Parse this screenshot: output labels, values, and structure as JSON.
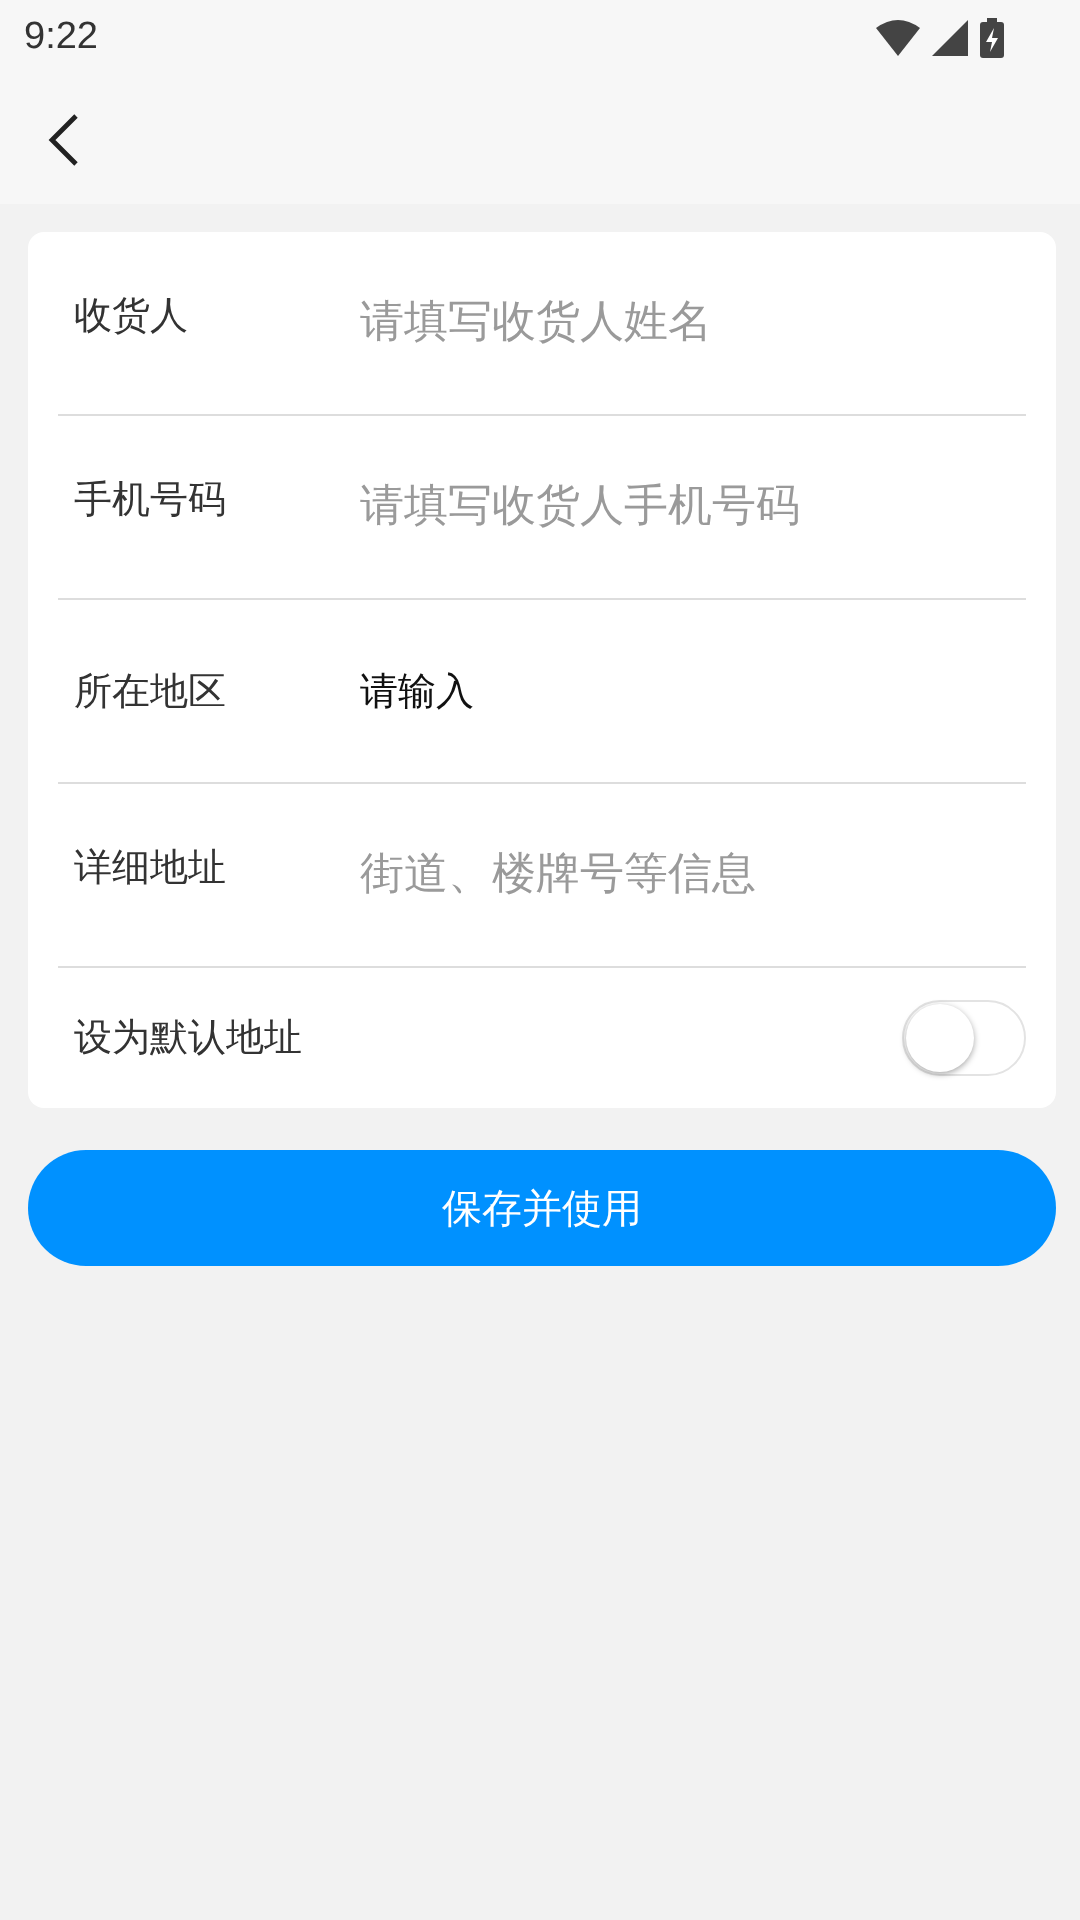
{
  "status_bar": {
    "time": "9:22"
  },
  "form": {
    "fields": [
      {
        "kind": "input",
        "label": "收货人",
        "placeholder": "请填写收货人姓名"
      },
      {
        "kind": "input",
        "label": "手机号码",
        "placeholder": "请填写收货人手机号码"
      },
      {
        "kind": "select",
        "label": "所在地区",
        "value": "请输入"
      },
      {
        "kind": "input",
        "label": "详细地址",
        "placeholder": "街道、楼牌号等信息"
      }
    ],
    "default_switch": {
      "label": "设为默认地址",
      "on": false
    }
  },
  "submit_button": "保存并使用"
}
